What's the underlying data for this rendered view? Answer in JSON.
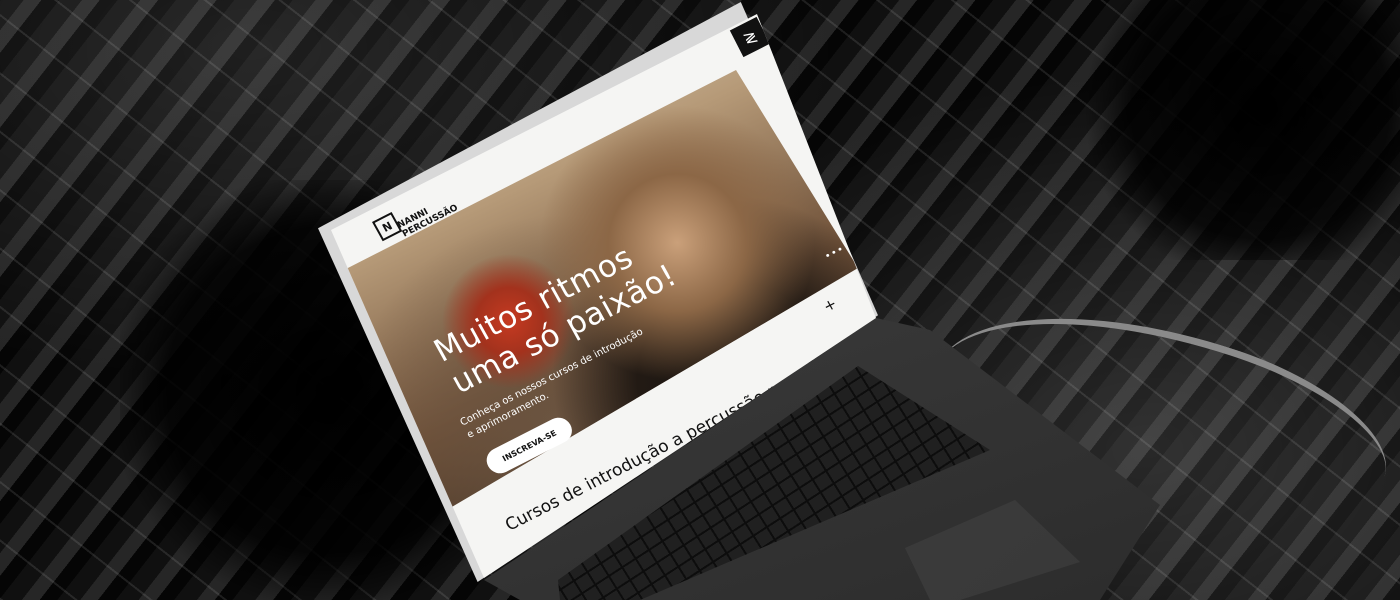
{
  "site": {
    "logo_mark": "N",
    "logo_line1": "NANNI",
    "logo_line2": "PERCUSSÃO",
    "menu_icon": "≷"
  },
  "hero": {
    "headline_line1": "Muitos ritmos",
    "headline_line2": "uma só paixão!",
    "subtitle_line1": "Conheça os nossos cursos de introdução",
    "subtitle_line2": "e aprimoramento.",
    "cta_label": "INSCREVA-SE",
    "more_icon": "•••",
    "plus_icon": "+"
  },
  "section": {
    "title": "Cursos de introdução a percussão por ritmos."
  },
  "colors": {
    "page_bg": "#f5f5f3",
    "text_dark": "#111111",
    "hero_text": "#ffffff",
    "accent_red": "#c63a21"
  }
}
